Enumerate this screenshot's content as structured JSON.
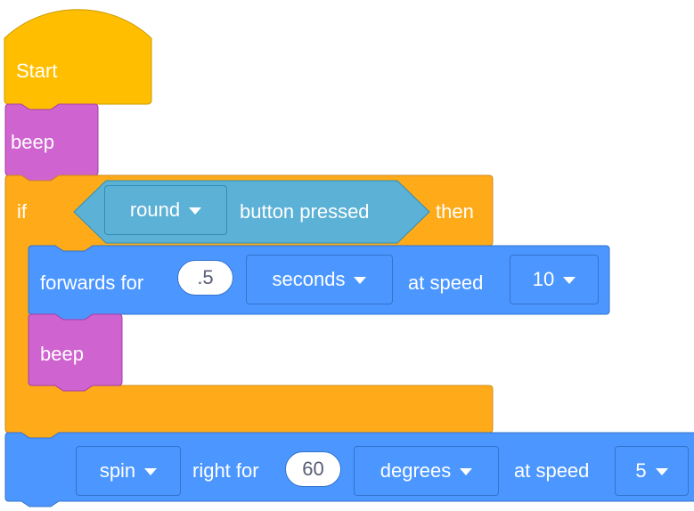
{
  "colors": {
    "events": "#FFBF00",
    "control": "#FFAB19",
    "sound": "#CF63CF",
    "motion": "#4C97FF",
    "sensing": "#5CB1D6"
  },
  "start_block": {
    "label": "Start"
  },
  "beep_block_1": {
    "label": "beep"
  },
  "if_block": {
    "if_label": "if",
    "condition": {
      "dropdown_value": "round",
      "label": "button pressed"
    },
    "then_label": "then"
  },
  "forwards_block": {
    "label": "forwards for",
    "duration_value": ".5",
    "unit_value": "seconds",
    "speed_label": "at speed",
    "speed_value": "10"
  },
  "beep_block_2": {
    "label": "beep"
  },
  "spin_block": {
    "direction_value": "spin",
    "label": "right for",
    "amount_value": "60",
    "unit_value": "degrees",
    "speed_label": "at speed",
    "speed_value": "5"
  }
}
